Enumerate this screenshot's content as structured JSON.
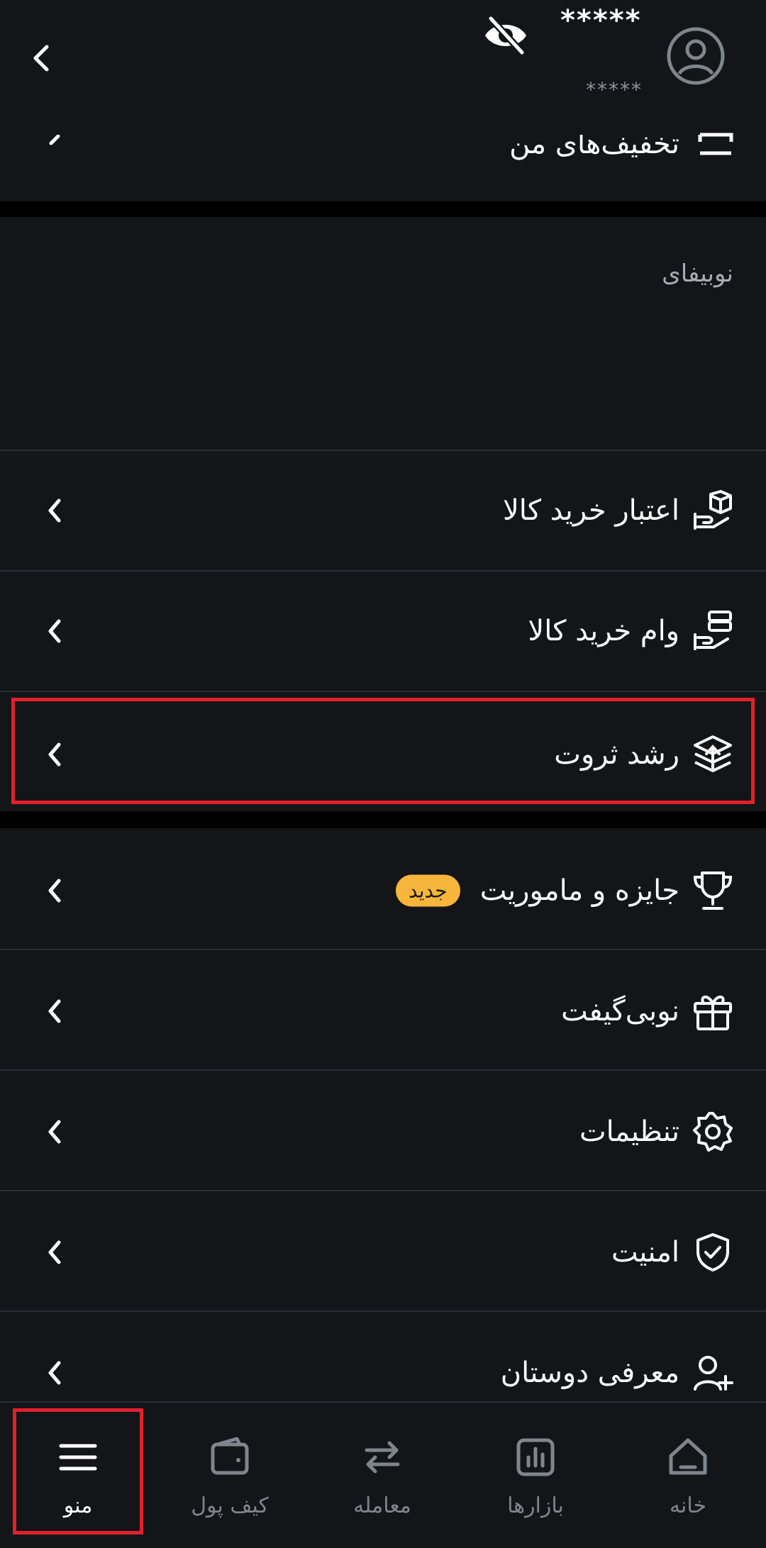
{
  "header": {
    "balance_primary": "*****",
    "balance_secondary": "*****",
    "partial_item_label": "تخفیف‌های من"
  },
  "section_nobipay": {
    "title": "نوبیفای"
  },
  "menu_finance": [
    {
      "label": "اعتبار خرید کالا",
      "icon": "hand-package-icon"
    },
    {
      "label": "وام خرید کالا",
      "icon": "hand-loan-icon"
    },
    {
      "label": "رشد ثروت",
      "icon": "stack-growth-icon"
    }
  ],
  "menu_general": [
    {
      "label": "جایزه و ماموریت",
      "icon": "trophy-icon",
      "badge": "جدید"
    },
    {
      "label": "نوبی‌گیفت",
      "icon": "gift-icon"
    },
    {
      "label": "تنظیمات",
      "icon": "gear-icon"
    },
    {
      "label": "امنیت",
      "icon": "shield-check-icon"
    },
    {
      "label": "معرفی دوستان",
      "icon": "user-plus-icon"
    }
  ],
  "bottom_nav": [
    {
      "label": "منو",
      "icon": "menu-icon",
      "active": true
    },
    {
      "label": "کیف پول",
      "icon": "wallet-icon",
      "active": false
    },
    {
      "label": "معامله",
      "icon": "swap-icon",
      "active": false
    },
    {
      "label": "بازارها",
      "icon": "chart-icon",
      "active": false
    },
    {
      "label": "خانه",
      "icon": "home-icon",
      "active": false
    }
  ],
  "colors": {
    "background": "#131518",
    "divider": "#2a2d32",
    "badge": "#f7b63b",
    "highlight": "#e3202a",
    "nav_inactive": "#7f858d"
  }
}
